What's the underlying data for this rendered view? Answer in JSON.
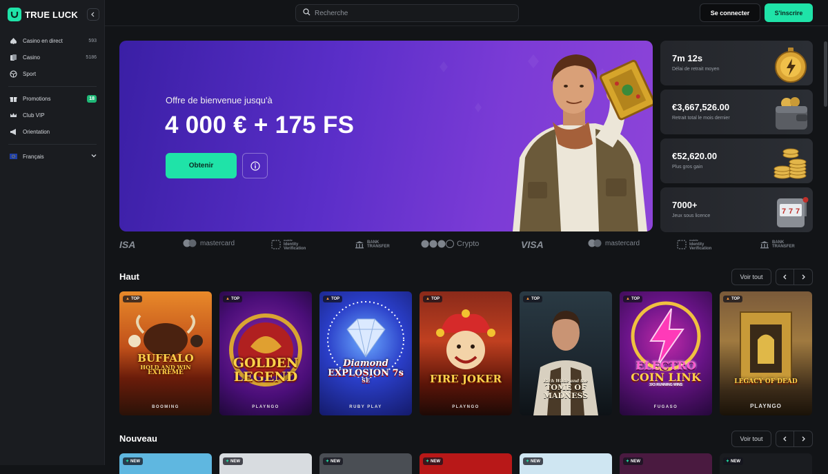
{
  "brand": {
    "name": "TRUE LUCK",
    "accent": "#1fe3a8"
  },
  "sidebar": {
    "items": [
      {
        "label": "Casino en direct",
        "count": "593",
        "icon": "spade-icon"
      },
      {
        "label": "Casino",
        "count": "5186",
        "icon": "cards-icon"
      },
      {
        "label": "Sport",
        "count": "",
        "icon": "soccer-ball-icon"
      },
      {
        "label": "Promotions",
        "badge": "18",
        "icon": "gift-icon"
      },
      {
        "label": "Club VIP",
        "count": "",
        "icon": "crown-icon"
      },
      {
        "label": "Orientation",
        "count": "",
        "icon": "megaphone-icon"
      }
    ],
    "language": {
      "label": "Français",
      "icon": "eu-flag-icon"
    }
  },
  "header": {
    "search_placeholder": "Recherche",
    "login_label": "Se connecter",
    "signup_label": "S'inscrire"
  },
  "hero": {
    "subtitle": "Offre de bienvenue jusqu'à",
    "title": "4 000 € + 175 FS",
    "cta_label": "Obtenir"
  },
  "stats": [
    {
      "value": "7m 12s",
      "label": "Délai de retrait moyen",
      "icon": "stopwatch-icon"
    },
    {
      "value": "€3,667,526.00",
      "label": "Retrait total le mois dernier",
      "icon": "wallet-icon"
    },
    {
      "value": "€52,620.00",
      "label": "Plus gros gain",
      "icon": "coins-icon"
    },
    {
      "value": "7000+",
      "label": "Jeux sous licence",
      "icon": "slot-machine-icon"
    }
  ],
  "payments": {
    "visa": "VISA",
    "visa_partial": "ISA",
    "mastercard": "mastercard",
    "identity_lines": [
      "mobile",
      "Identity",
      "Verification"
    ],
    "bank_lines": [
      "BANK",
      "TRANSFER"
    ],
    "crypto": "Crypto"
  },
  "sections": {
    "top": {
      "title": "Haut",
      "see_all": "Voir tout"
    },
    "new": {
      "title": "Nouveau",
      "see_all": "Voir tout"
    }
  },
  "tags": {
    "top": "TOP",
    "new": "NEW"
  },
  "games_top": [
    {
      "title_lines": [
        "BUFFALO",
        "HOLD AND WIN",
        "EXTREME"
      ],
      "provider": "BOOMING"
    },
    {
      "title_lines": [
        "GOLDEN",
        "LEGEND"
      ],
      "provider": "PLAYNGO"
    },
    {
      "title_lines": [
        "Diamond",
        "EXPLOSION 7s",
        "SE"
      ],
      "provider": "RUBY PLAY"
    },
    {
      "title_lines": [
        "FIRE JOKER"
      ],
      "provider": "PLAYNGO"
    },
    {
      "title_lines": [
        "Rich Wilde and the",
        "TOME OF",
        "MADNESS"
      ],
      "provider": ""
    },
    {
      "title_lines": [
        "ELECTRO",
        "COIN LINK",
        "3X3 RUNNING WINS"
      ],
      "provider": "FUGASO"
    },
    {
      "title_lines": [
        "LEGACY OF DEAD"
      ],
      "provider": "PLAYNGO"
    }
  ]
}
